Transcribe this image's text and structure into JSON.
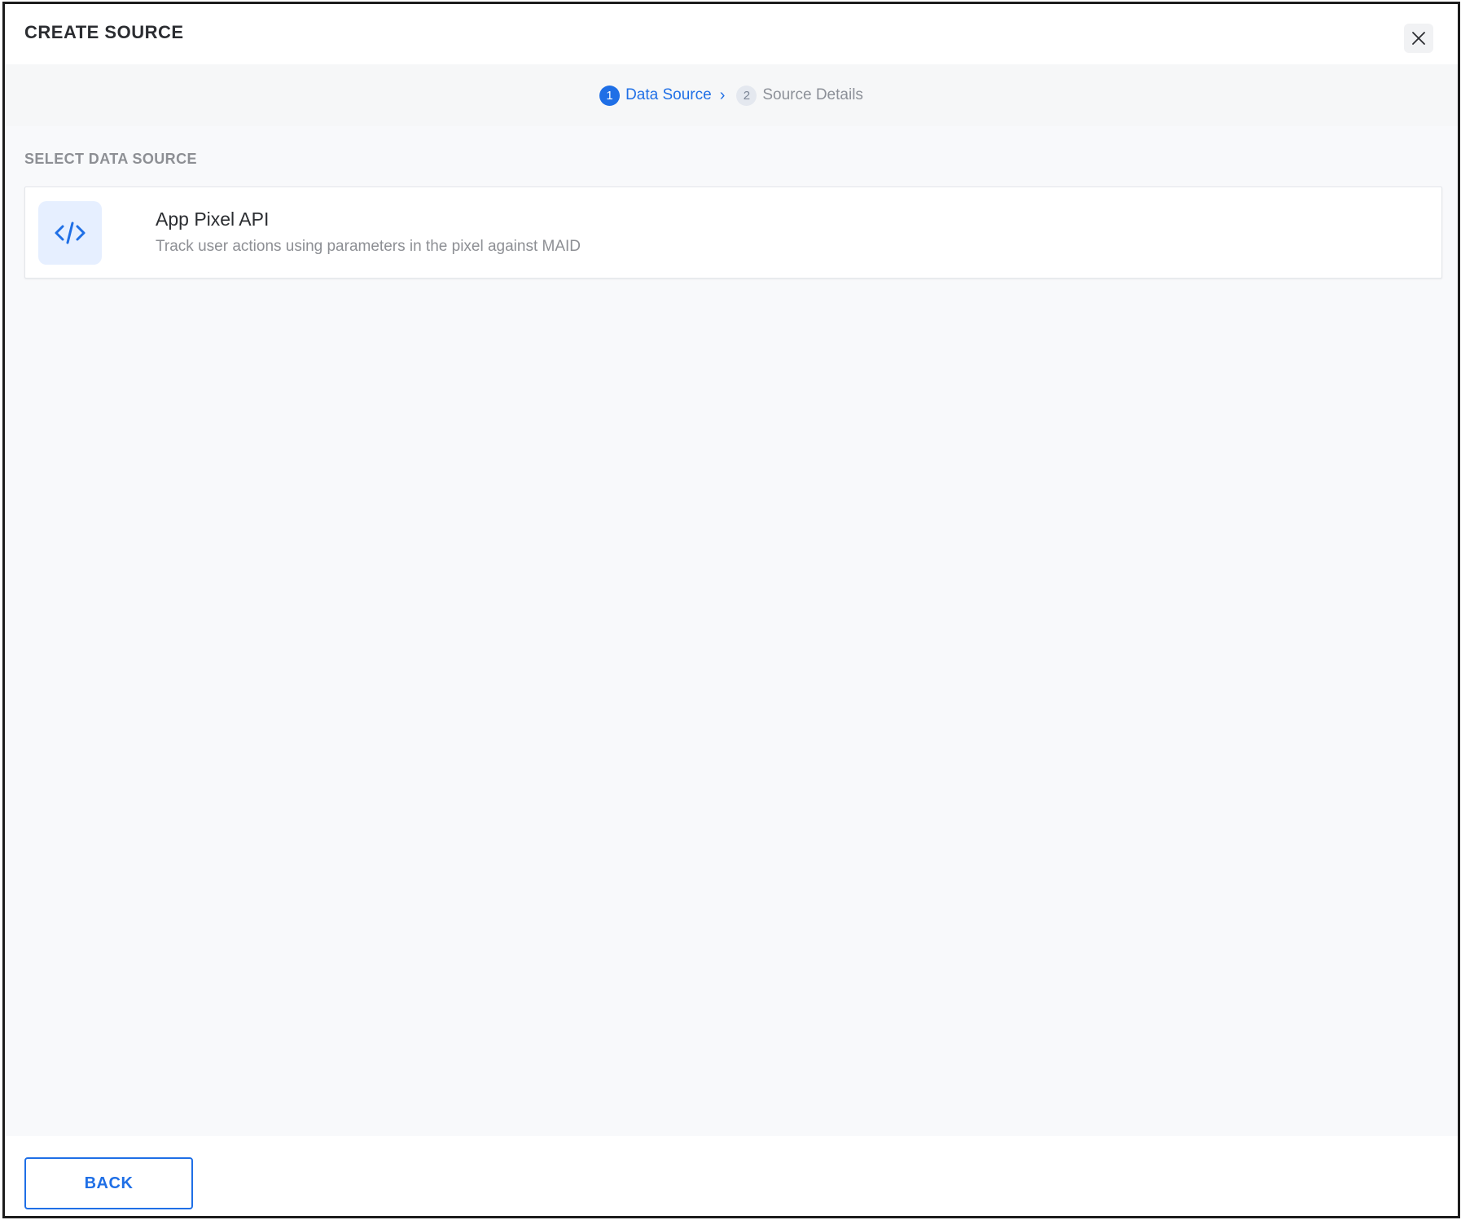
{
  "dialog": {
    "title": "CREATE SOURCE",
    "close_icon": "close-icon"
  },
  "stepper": {
    "steps": [
      {
        "number": "1",
        "label": "Data Source",
        "state": "active"
      },
      {
        "number": "2",
        "label": "Source Details",
        "state": "inactive"
      }
    ],
    "separator_icon": "chevron-right-icon"
  },
  "content": {
    "section_label": "SELECT DATA SOURCE",
    "sources": [
      {
        "icon": "code-icon",
        "title": "App Pixel API",
        "description": "Track user actions using parameters in the pixel against MAID"
      }
    ]
  },
  "footer": {
    "back_label": "BACK"
  },
  "colors": {
    "accent": "#1f6fe6",
    "icon_bg": "#e6efff",
    "content_bg": "#f8f9fb",
    "stepper_bg": "#f6f7f8"
  }
}
